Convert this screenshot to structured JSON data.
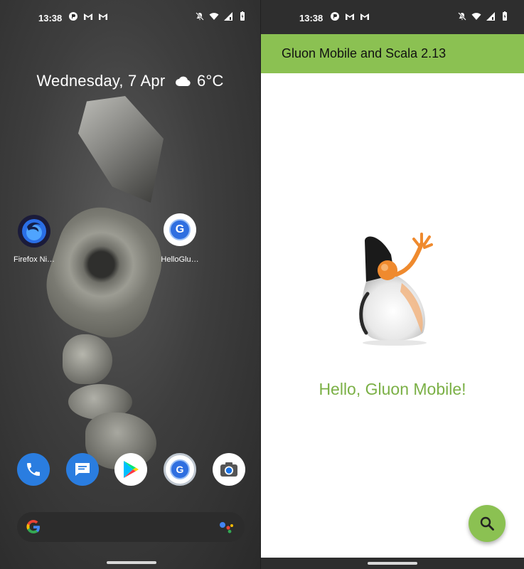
{
  "status_bar": {
    "time": "13:38",
    "left_icons": [
      "alarm-app-icon",
      "gmail-icon",
      "gmail-icon"
    ],
    "right_icons": [
      "mute-bell-icon",
      "wifi-icon",
      "signal-icon",
      "battery-icon"
    ]
  },
  "home_screen": {
    "date_weather": "Wednesday, 7 Apr",
    "weather_icon": "cloud-icon",
    "temperature": "6°C",
    "apps": [
      {
        "label": "Firefox Ni…",
        "icon": "firefox-nightly-icon"
      },
      {
        "label": "HelloGlu…",
        "icon": "gluon-app-icon"
      }
    ],
    "dock": [
      {
        "name": "phone",
        "icon": "phone-icon"
      },
      {
        "name": "messages",
        "icon": "messages-icon"
      },
      {
        "name": "play-store",
        "icon": "play-store-icon"
      },
      {
        "name": "gluon",
        "icon": "gluon-app-icon"
      },
      {
        "name": "camera",
        "icon": "camera-icon"
      }
    ],
    "search": {
      "logo": "G",
      "assistant_icon": "google-assistant-icon"
    }
  },
  "app": {
    "title": "Gluon Mobile and Scala 2.13",
    "greeting": "Hello, Gluon Mobile!",
    "fab_icon": "search-icon",
    "accent_color": "#8bc152",
    "text_color": "#7bb046"
  }
}
